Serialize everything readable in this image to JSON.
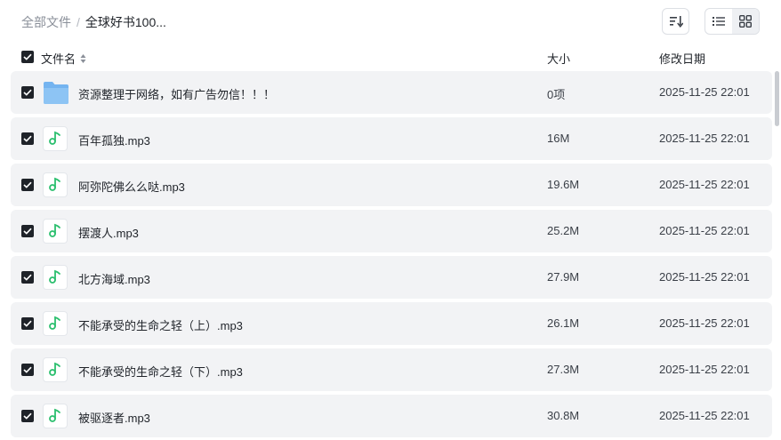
{
  "breadcrumb": {
    "root": "全部文件",
    "separator": "/",
    "current": "全球好书100..."
  },
  "toolbar": {
    "sort_icon": "sort-descending-icon",
    "view_modes": [
      "list-view-icon",
      "grid-view-icon"
    ],
    "active_view": "list"
  },
  "columns": {
    "name": "文件名",
    "size": "大小",
    "modified": "修改日期"
  },
  "colors": {
    "row_background": "#f2f3f5",
    "checkbox": "#1f2329",
    "music_icon": "#2bbf6e",
    "folder_icon": "#74b4f0"
  },
  "files": [
    {
      "type": "folder",
      "icon": "folder-icon",
      "name": "资源整理于网络，如有广告勿信！！！",
      "size": "0项",
      "modified": "2025-11-25 22:01",
      "checked": true
    },
    {
      "type": "audio",
      "icon": "music-file-icon",
      "name": "百年孤独.mp3",
      "size": "16M",
      "modified": "2025-11-25 22:01",
      "checked": true
    },
    {
      "type": "audio",
      "icon": "music-file-icon",
      "name": "阿弥陀佛么么哒.mp3",
      "size": "19.6M",
      "modified": "2025-11-25 22:01",
      "checked": true
    },
    {
      "type": "audio",
      "icon": "music-file-icon",
      "name": "摆渡人.mp3",
      "size": "25.2M",
      "modified": "2025-11-25 22:01",
      "checked": true
    },
    {
      "type": "audio",
      "icon": "music-file-icon",
      "name": "北方海域.mp3",
      "size": "27.9M",
      "modified": "2025-11-25 22:01",
      "checked": true
    },
    {
      "type": "audio",
      "icon": "music-file-icon",
      "name": "不能承受的生命之轻（上）.mp3",
      "size": "26.1M",
      "modified": "2025-11-25 22:01",
      "checked": true
    },
    {
      "type": "audio",
      "icon": "music-file-icon",
      "name": "不能承受的生命之轻（下）.mp3",
      "size": "27.3M",
      "modified": "2025-11-25 22:01",
      "checked": true
    },
    {
      "type": "audio",
      "icon": "music-file-icon",
      "name": "被驱逐者.mp3",
      "size": "30.8M",
      "modified": "2025-11-25 22:01",
      "checked": true
    }
  ]
}
